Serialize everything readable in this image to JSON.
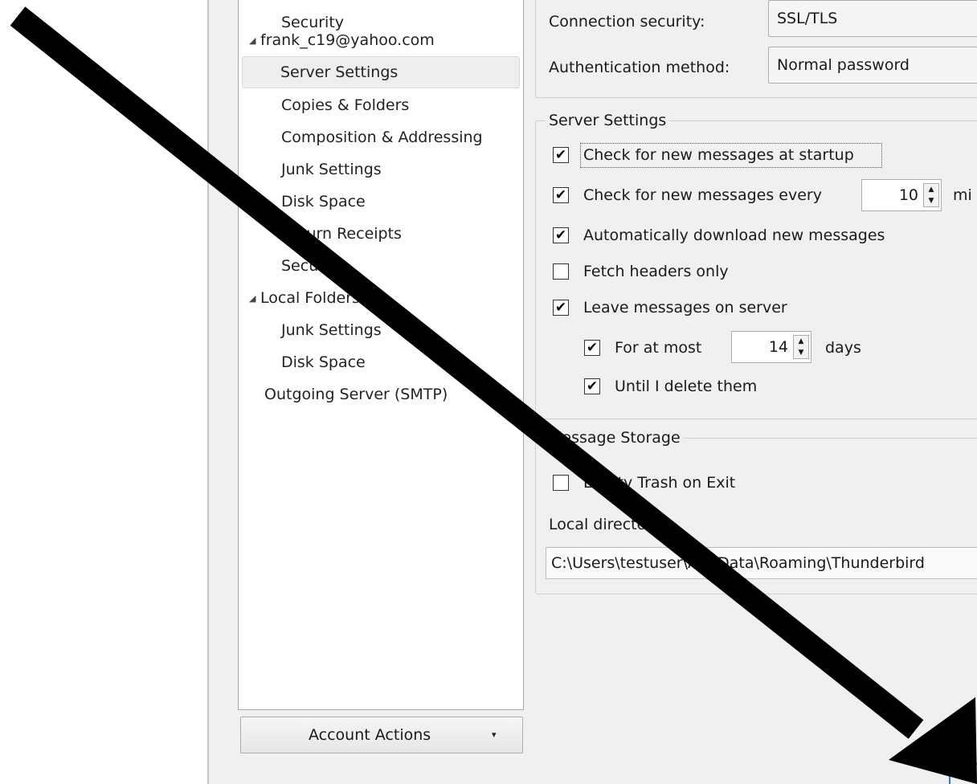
{
  "tree": {
    "items": [
      {
        "label": "Security",
        "level": 1
      },
      {
        "label": "frank_c19@yahoo.com",
        "level": 0,
        "expanded": true
      },
      {
        "label": "Server Settings",
        "level": 1,
        "selected": true
      },
      {
        "label": "Copies & Folders",
        "level": 1
      },
      {
        "label": "Composition & Addressing",
        "level": 1
      },
      {
        "label": "Junk Settings",
        "level": 1
      },
      {
        "label": "Disk Space",
        "level": 1
      },
      {
        "label": "Return Receipts",
        "level": 1
      },
      {
        "label": "Security",
        "level": 1
      },
      {
        "label": "Local Folders",
        "level": 0,
        "expanded": true
      },
      {
        "label": "Junk Settings",
        "level": 1
      },
      {
        "label": "Disk Space",
        "level": 1
      },
      {
        "label": "Outgoing Server (SMTP)",
        "level": 0
      }
    ],
    "twisty_glyph": "◢"
  },
  "account_actions": {
    "label": "Account Actions",
    "caret": "▾"
  },
  "connection": {
    "security_label": "Connection security:",
    "security_value": "SSL/TLS",
    "auth_label": "Authentication method:",
    "auth_value": "Normal password",
    "chevron": "⌄"
  },
  "server_settings": {
    "title": "Server Settings",
    "check_startup": {
      "label": "Check for new messages at startup",
      "checked": true
    },
    "check_every": {
      "label": "Check for new messages every",
      "checked": true,
      "value": "10",
      "unit_partial": "mi"
    },
    "auto_download": {
      "label": "Automatically download new messages",
      "checked": true
    },
    "headers_only": {
      "label": "Fetch headers only",
      "checked": false
    },
    "leave_on_server": {
      "label": "Leave messages on server",
      "checked": true
    },
    "for_at_most": {
      "label": "For at most",
      "checked": true,
      "value": "14",
      "unit": "days"
    },
    "until_delete": {
      "label": "Until I delete them",
      "checked": true
    }
  },
  "message_storage": {
    "title": "Message Storage",
    "empty_trash": {
      "label": "Empty Trash on Exit",
      "checked": false
    },
    "local_dir_label": "Local directory:",
    "local_dir_value": "C:\\Users\\testuser\\AppData\\Roaming\\Thunderbird"
  },
  "check_glyph": "✔",
  "spin_glyph": "▲\n▼",
  "colors": {
    "arrow": "#000000",
    "dialog_bg": "#f0f0f0",
    "selection": "#eeeeee",
    "accent": "#2e7bd6"
  }
}
